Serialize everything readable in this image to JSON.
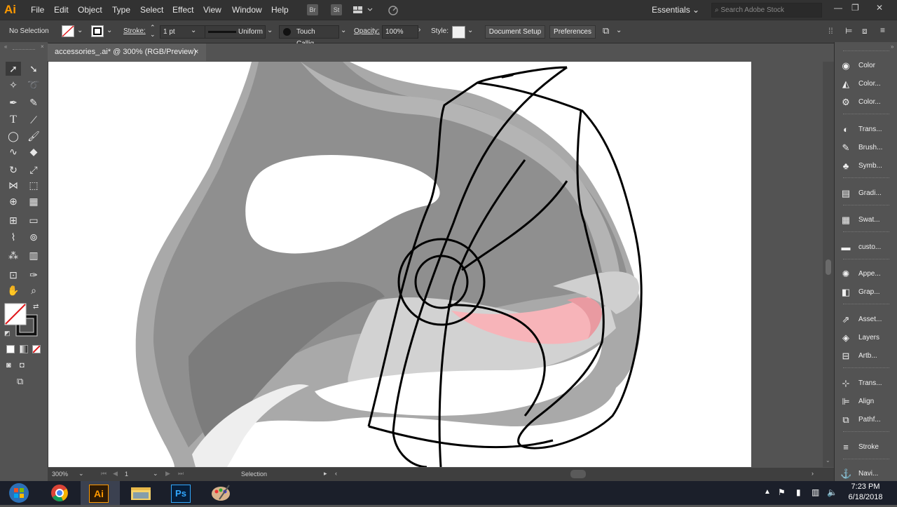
{
  "app": {
    "logo": "Ai"
  },
  "menu": [
    "File",
    "Edit",
    "Object",
    "Type",
    "Select",
    "Effect",
    "View",
    "Window",
    "Help"
  ],
  "menu_buttons": {
    "bridge": "Br",
    "stock": "St"
  },
  "workspace": {
    "label": "Essentials"
  },
  "search": {
    "placeholder": "Search Adobe Stock"
  },
  "window_controls": {
    "minimize": "—",
    "restore": "❐",
    "close": "✕"
  },
  "control_bar": {
    "selection": "No Selection",
    "stroke_label": "Stroke:",
    "stroke_weight": "1 pt",
    "profile": "Uniform",
    "brush": "Touch Callig...",
    "opacity_label": "Opacity:",
    "opacity_value": "100%",
    "style_label": "Style:",
    "document_setup": "Document Setup",
    "preferences": "Preferences"
  },
  "document_tab": {
    "title": "accessories_.ai* @ 300% (RGB/Preview)",
    "close": "×"
  },
  "status_bar": {
    "zoom": "300%",
    "artboard": "1",
    "tool": "Selection"
  },
  "panels": [
    {
      "label": "Color",
      "icon": "color-icon"
    },
    {
      "label": "Color...",
      "icon": "color-guide-icon"
    },
    {
      "label": "Color...",
      "icon": "color-themes-icon"
    },
    {
      "label": "Trans...",
      "icon": "transparency-icon"
    },
    {
      "label": "Brush...",
      "icon": "brushes-icon"
    },
    {
      "label": "Symb...",
      "icon": "symbols-icon"
    },
    {
      "label": "Gradi...",
      "icon": "gradient-icon"
    },
    {
      "label": "Swat...",
      "icon": "swatches-icon"
    },
    {
      "label": "custo...",
      "icon": "custom-library-icon"
    },
    {
      "label": "Appe...",
      "icon": "appearance-icon"
    },
    {
      "label": "Grap...",
      "icon": "graphic-styles-icon"
    },
    {
      "label": "Asset...",
      "icon": "asset-export-icon"
    },
    {
      "label": "Layers",
      "icon": "layers-icon"
    },
    {
      "label": "Artb...",
      "icon": "artboards-icon"
    },
    {
      "label": "Trans...",
      "icon": "transform-icon"
    },
    {
      "label": "Align",
      "icon": "align-icon"
    },
    {
      "label": "Pathf...",
      "icon": "pathfinder-icon"
    },
    {
      "label": "Stroke",
      "icon": "stroke-icon"
    },
    {
      "label": "Navi...",
      "icon": "navigator-icon"
    }
  ],
  "taskbar": {
    "items": [
      "Windows Start",
      "Chrome",
      "Illustrator",
      "File Explorer",
      "Photoshop",
      "Paint"
    ],
    "illustrator_label": "Ai",
    "photoshop_label": "Ps"
  },
  "clock": {
    "time": "7:23 PM",
    "date": "6/18/2018"
  },
  "colors": {
    "menubar": "#323232",
    "controlbar": "#424242",
    "workspace": "#535353",
    "ai_accent": "#ff9a00",
    "orca_dark": "#8f8f8f",
    "orca_light": "#c6c6c6",
    "orca_outline": "#a8a8a8",
    "mouth_pink": "#f7b4b9"
  }
}
